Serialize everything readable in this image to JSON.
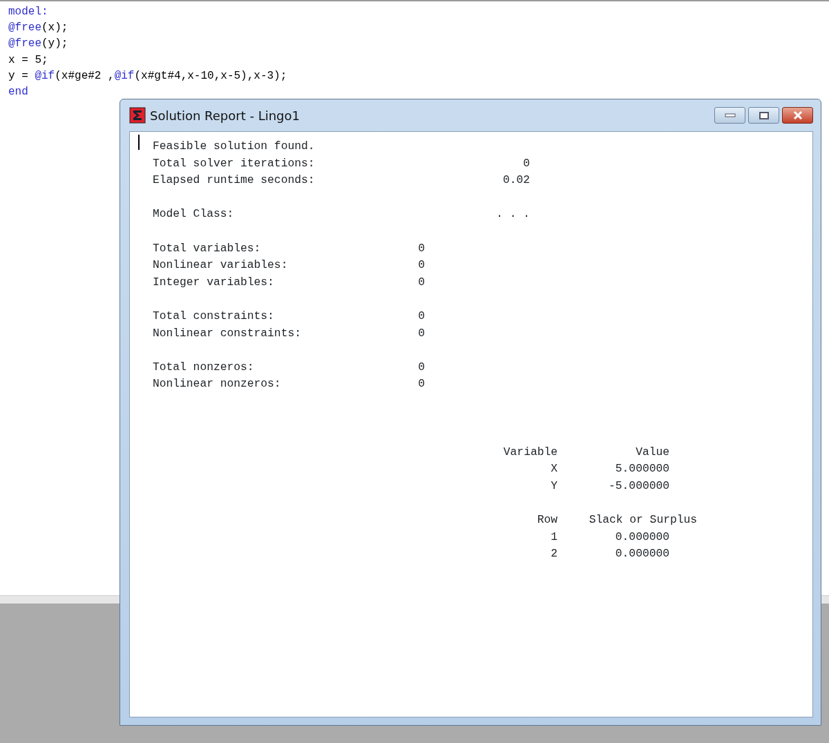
{
  "editor": {
    "lines": [
      [
        {
          "text": "model:",
          "kind": "keyword"
        }
      ],
      [
        {
          "text": "@free",
          "kind": "keyword"
        },
        {
          "text": "(x);",
          "kind": "plain"
        }
      ],
      [
        {
          "text": "@free",
          "kind": "keyword"
        },
        {
          "text": "(y);",
          "kind": "plain"
        }
      ],
      [
        {
          "text": "x = 5;",
          "kind": "plain"
        }
      ],
      [
        {
          "text": "y = ",
          "kind": "plain"
        },
        {
          "text": "@if",
          "kind": "keyword"
        },
        {
          "text": "(x#ge#2 ,",
          "kind": "plain"
        },
        {
          "text": "@if",
          "kind": "keyword"
        },
        {
          "text": "(x#gt#4,x-10,x-5),x-3);",
          "kind": "plain"
        }
      ],
      [
        {
          "text": "end",
          "kind": "keyword"
        }
      ]
    ]
  },
  "report_window": {
    "title": "Solution Report - Lingo1",
    "status": "Feasible solution found.",
    "stats_groups": [
      {
        "kind": "wide",
        "rows": [
          {
            "label": "Total solver iterations:",
            "value": "0"
          },
          {
            "label": "Elapsed runtime seconds:",
            "value": "0.02"
          }
        ]
      },
      {
        "kind": "wide",
        "rows": [
          {
            "label": "Model Class:",
            "value": ". . ."
          }
        ]
      },
      {
        "kind": "narrow",
        "rows": [
          {
            "label": "Total variables:",
            "value": "0"
          },
          {
            "label": "Nonlinear variables:",
            "value": "0"
          },
          {
            "label": "Integer variables:",
            "value": "0"
          }
        ]
      },
      {
        "kind": "narrow",
        "rows": [
          {
            "label": "Total constraints:",
            "value": "0"
          },
          {
            "label": "Nonlinear constraints:",
            "value": "0"
          }
        ]
      },
      {
        "kind": "narrow",
        "rows": [
          {
            "label": "Total nonzeros:",
            "value": "0"
          },
          {
            "label": "Nonlinear nonzeros:",
            "value": "0"
          }
        ]
      }
    ],
    "tables": [
      {
        "columns": [
          "Variable",
          "Value"
        ],
        "rows": [
          [
            "X",
            "5.000000"
          ],
          [
            "Y",
            "-5.000000"
          ]
        ]
      },
      {
        "columns": [
          "Row",
          "Slack or Surplus"
        ],
        "rows": [
          [
            "1",
            "0.000000"
          ],
          [
            "2",
            "0.000000"
          ]
        ]
      }
    ]
  }
}
